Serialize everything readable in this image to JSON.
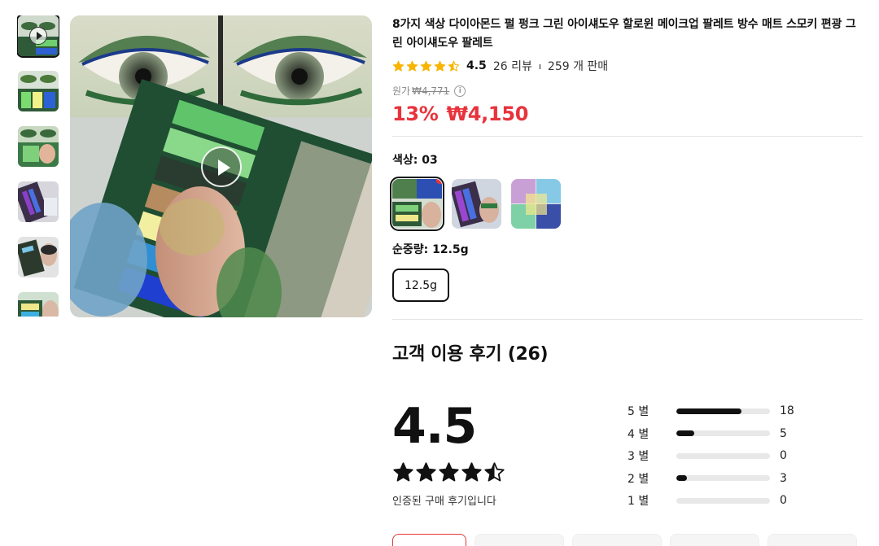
{
  "product": {
    "title": "8가지 색상 다이아몬드 펄 펑크 그린 아이섀도우 할로윈 메이크업 팔레트 방수 매트 스모키 편광 그린 아이섀도우 팔레트",
    "rating": "4.5",
    "rating_value": 4.5,
    "review_count_text": "26 리뷰",
    "sold_text": "259 개 판매",
    "original_price_label": "원가",
    "original_price": "₩4,771",
    "info_icon": "i",
    "discount": "13%",
    "price": "₩4,150"
  },
  "options": {
    "color_label": "색상: 03",
    "weight_label": "순중량: 12.5g",
    "weight_value": "12.5g",
    "swatch_names": [
      "swatch-03",
      "swatch-purple-green",
      "swatch-multi"
    ]
  },
  "reviews": {
    "title": "고객 이용 후기 (26)",
    "score": "4.5",
    "score_value": 4.5,
    "verified": "인증된 구매 후기입니다",
    "histogram": [
      {
        "label": "5 별",
        "count": "18",
        "value": 18
      },
      {
        "label": "4 별",
        "count": "5",
        "value": 5
      },
      {
        "label": "3 별",
        "count": "0",
        "value": 0
      },
      {
        "label": "2 별",
        "count": "3",
        "value": 3
      },
      {
        "label": "1 별",
        "count": "0",
        "value": 0
      }
    ]
  },
  "icons": {
    "star": "star-icon",
    "play": "play-icon",
    "hot": "fire-icon",
    "info": "info-icon"
  },
  "colors": {
    "accent_red": "#e8333c",
    "star_yellow": "#f7b500",
    "dark": "#111111"
  }
}
